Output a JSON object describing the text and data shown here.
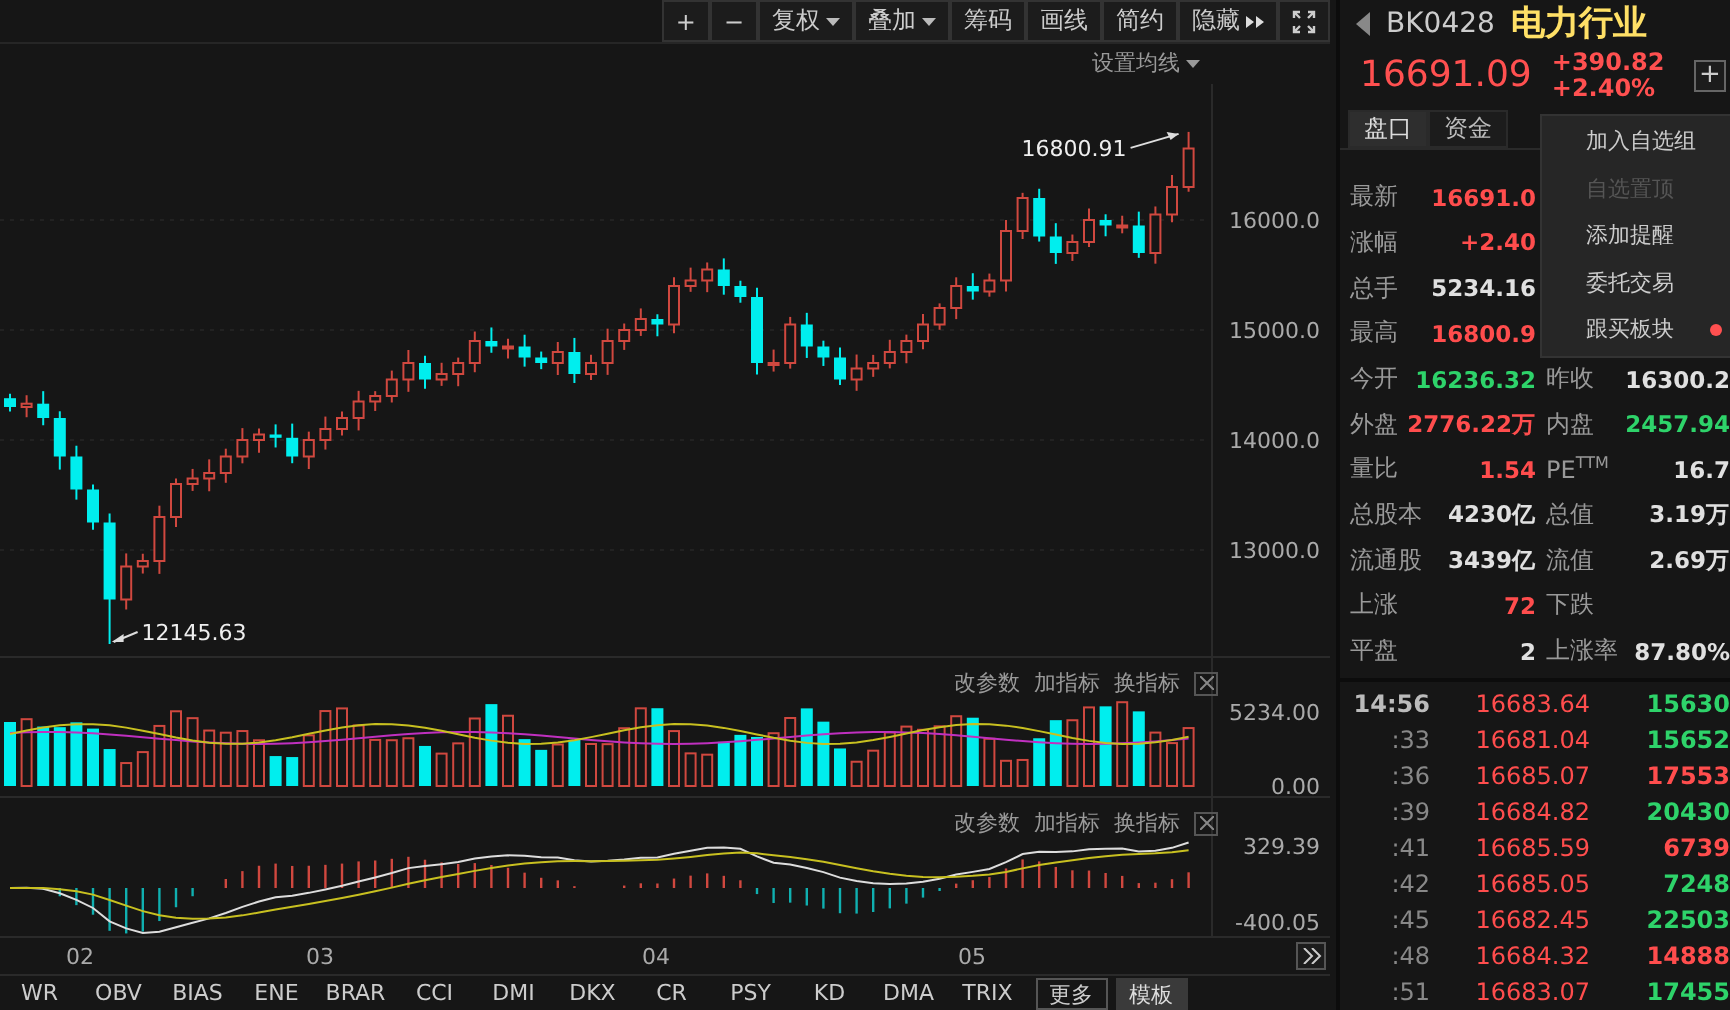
{
  "toolbar": {
    "buttons": [
      {
        "label": "+",
        "kind": "plain"
      },
      {
        "label": "−",
        "kind": "plain"
      },
      {
        "label": "复权",
        "kind": "dropdown"
      },
      {
        "label": "叠加",
        "kind": "dropdown"
      },
      {
        "label": "筹码",
        "kind": "plain"
      },
      {
        "label": "画线",
        "kind": "plain"
      },
      {
        "label": "简约",
        "kind": "plain"
      },
      {
        "label": "隐藏",
        "kind": "more"
      },
      {
        "kind": "fullscreen"
      }
    ]
  },
  "chart": {
    "ma_setting": "设置均线",
    "y_ticks": [
      "16000.0",
      "15000.0",
      "14000.0",
      "13000.0"
    ],
    "high_label": "16800.91",
    "low_label": "12145.63"
  },
  "volume_panel": {
    "actions": [
      "改参数",
      "加指标",
      "换指标"
    ],
    "y_labels": [
      "5234.00",
      "0.00"
    ]
  },
  "macd_panel": {
    "actions": [
      "改参数",
      "加指标",
      "换指标"
    ],
    "y_labels": [
      "329.39",
      "-400.05"
    ]
  },
  "x_labels": [
    "02",
    "03",
    "04",
    "05"
  ],
  "indicator_tabs": [
    {
      "label": "WR",
      "kind": "indicator",
      "selected": false
    },
    {
      "label": "OBV",
      "kind": "indicator",
      "selected": false
    },
    {
      "label": "BIAS",
      "kind": "indicator",
      "selected": false
    },
    {
      "label": "ENE",
      "kind": "indicator",
      "selected": false
    },
    {
      "label": "BRAR",
      "kind": "indicator",
      "selected": false
    },
    {
      "label": "CCI",
      "kind": "indicator",
      "selected": false
    },
    {
      "label": "DMI",
      "kind": "indicator",
      "selected": false
    },
    {
      "label": "DKX",
      "kind": "indicator",
      "selected": false
    },
    {
      "label": "CR",
      "kind": "indicator",
      "selected": false
    },
    {
      "label": "PSY",
      "kind": "indicator",
      "selected": false
    },
    {
      "label": "KD",
      "kind": "indicator",
      "selected": false
    },
    {
      "label": "DMA",
      "kind": "indicator",
      "selected": false
    },
    {
      "label": "TRIX",
      "kind": "indicator",
      "selected": false
    },
    {
      "label": "更多",
      "kind": "button",
      "selected": false
    },
    {
      "label": "模板",
      "kind": "button",
      "selected": true
    }
  ],
  "quote": {
    "code": "BK0428",
    "name": "电力行业",
    "price": "16691.09",
    "change": "+390.82",
    "change_pct": "+2.40%",
    "add_button": "+"
  },
  "panel_tabs": [
    {
      "label": "盘口",
      "selected": true
    },
    {
      "label": "资金",
      "selected": false
    }
  ],
  "menu": {
    "items": [
      {
        "label": "加入自选组",
        "disabled": false,
        "dot": false
      },
      {
        "label": "自选置顶",
        "disabled": true,
        "dot": false
      },
      {
        "label": "添加提醒",
        "disabled": false,
        "dot": false
      },
      {
        "label": "委托交易",
        "disabled": false,
        "dot": false
      },
      {
        "label": "跟买板块",
        "disabled": false,
        "dot": true
      }
    ]
  },
  "stats": [
    [
      {
        "label": "最新",
        "value": "16691.0",
        "color": "#ff4d4d"
      }
    ],
    [
      {
        "label": "涨幅",
        "value": "+2.40",
        "color": "#ff4d4d"
      }
    ],
    [
      {
        "label": "总手",
        "value": "5234.16",
        "color": "#e0e0e0"
      }
    ],
    [
      {
        "label": "最高",
        "value": "16800.9",
        "color": "#ff4d4d"
      }
    ],
    [
      {
        "label": "今开",
        "value": "16236.32",
        "color": "#2ed36a"
      },
      {
        "label": "昨收",
        "value": "16300.2",
        "color": "#e0e0e0"
      }
    ],
    [
      {
        "label": "外盘",
        "value": "2776.22万",
        "color": "#ff4d4d"
      },
      {
        "label": "内盘",
        "value": "2457.94",
        "color": "#2ed36a"
      }
    ],
    [
      {
        "label": "量比",
        "value": "1.54",
        "color": "#ff4d4d"
      },
      {
        "label": "PE$^{TTM}$",
        "value": "16.7",
        "color": "#e0e0e0"
      }
    ],
    [
      {
        "label": "总股本",
        "value": "4230亿",
        "color": "#e0e0e0"
      },
      {
        "label": "总值",
        "value": "3.19万",
        "color": "#e0e0e0"
      }
    ],
    [
      {
        "label": "流通股",
        "value": "3439亿",
        "color": "#e0e0e0"
      },
      {
        "label": "流值",
        "value": "2.69万",
        "color": "#e0e0e0"
      }
    ],
    [
      {
        "label": "上涨",
        "value": "72",
        "color": "#ff4d4d"
      },
      {
        "label": "下跌"
      }
    ],
    [
      {
        "label": "平盘",
        "value": "2",
        "color": "#e0e0e0"
      },
      {
        "label": "上涨率",
        "value": "87.80%",
        "color": "#e0e0e0"
      }
    ]
  ],
  "trades": [
    {
      "time": "14:56",
      "price": "16683.64",
      "volume": "15630",
      "color": "#2ed36a"
    },
    {
      "time": ":33",
      "price": "16681.04",
      "volume": "15652",
      "color": "#2ed36a"
    },
    {
      "time": ":36",
      "price": "16685.07",
      "volume": "17553",
      "color": "#ff4d4d"
    },
    {
      "time": ":39",
      "price": "16684.82",
      "volume": "20430",
      "color": "#2ed36a"
    },
    {
      "time": ":41",
      "price": "16685.59",
      "volume": "6739",
      "color": "#ff4d4d"
    },
    {
      "time": ":42",
      "price": "16685.05",
      "volume": "7248",
      "color": "#2ed36a"
    },
    {
      "time": ":45",
      "price": "16682.45",
      "volume": "22503",
      "color": "#2ed36a"
    },
    {
      "time": ":48",
      "price": "16684.32",
      "volume": "14888",
      "color": "#ff4d4d"
    },
    {
      "time": ":51",
      "price": "16683.07",
      "volume": "17455",
      "color": "#2ed36a"
    }
  ]
}
